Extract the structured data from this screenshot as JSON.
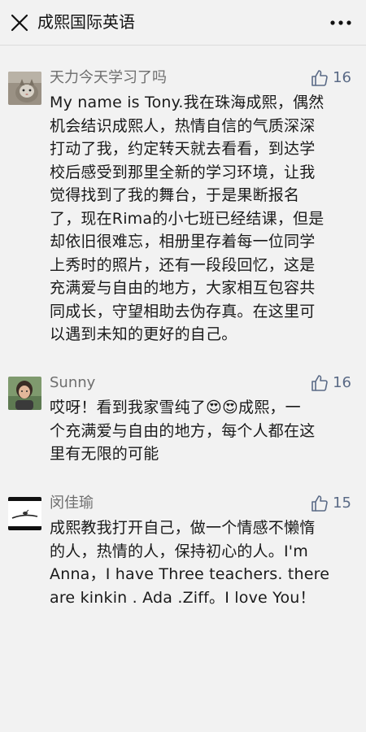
{
  "header": {
    "title": "成熙国际英语",
    "close_icon": "close-icon",
    "more_icon": "more-icon"
  },
  "comments": [
    {
      "name": "天力今天学习了吗",
      "likes": "16",
      "lines": [
        "My name is Tony.我在珠海成熙，偶然",
        "机会结识成熙人，热情自信的气质深深",
        "打动了我，约定转天就去看看，到达学",
        "校后感受到那里全新的学习环境，让我",
        "觉得找到了我的舞台，于是果断报名",
        "了，现在Rima的小七班已经结课，但是",
        "却依旧很难忘，相册里存着每一位同学",
        "上秀时的照片，还有一段段回忆，这是",
        "充满爱与自由的地方，大家相互包容共",
        "同成长，守望相助去伪存真。在这里可",
        "以遇到未知的更好的自己。"
      ]
    },
    {
      "name": "Sunny",
      "likes": "16",
      "lines": [
        "哎呀！看到我家雪纯了😍😍成熙，一",
        "个充满爱与自由的地方，每个人都在这",
        "里有无限的可能"
      ]
    },
    {
      "name": "闵佳瑜",
      "likes": "15",
      "lines": [
        "成熙教我打开自己，做一个情感不懒惰",
        "的人，热情的人，保持初心的人。I'm",
        "Anna，I have Three teachers. there",
        "are kinkin . Ada .Ziff。I love You！"
      ]
    }
  ],
  "colors": {
    "background": "#f2f2f2",
    "name": "#6e6e6e",
    "like_accent": "#5a6a86"
  }
}
